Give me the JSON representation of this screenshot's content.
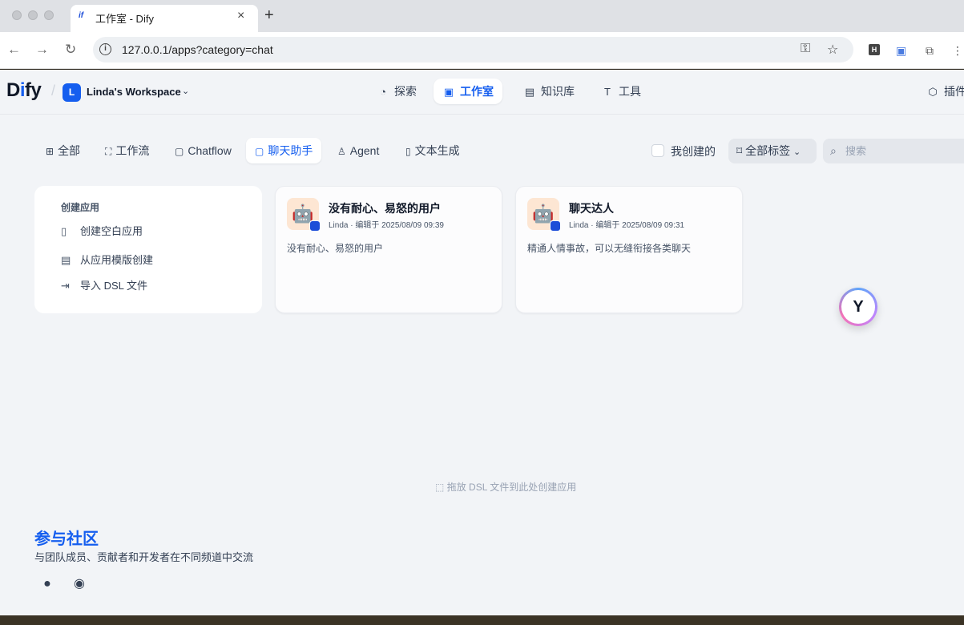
{
  "browser": {
    "tab_title": "工作室 - Dify",
    "tab_favicon": "if",
    "url": "127.0.0.1/apps?category=chat"
  },
  "header": {
    "logo_prefix": "D",
    "logo_i": "i",
    "logo_suffix": "fy",
    "workspace_initial": "L",
    "workspace_name": "Linda's Workspace",
    "nav": [
      {
        "label": "探索",
        "icon": "compass-icon"
      },
      {
        "label": "工作室",
        "icon": "robot-icon"
      },
      {
        "label": "知识库",
        "icon": "book-icon"
      },
      {
        "label": "工具",
        "icon": "hammer-icon"
      }
    ],
    "plugin_label": "插件"
  },
  "filters": {
    "tabs": [
      {
        "label": "全部"
      },
      {
        "label": "工作流"
      },
      {
        "label": "Chatflow"
      },
      {
        "label": "聊天助手"
      },
      {
        "label": "Agent"
      },
      {
        "label": "文本生成"
      }
    ],
    "mine_label": "我创建的",
    "tags_label": "全部标签",
    "search_placeholder": "搜索"
  },
  "create_card": {
    "title": "创建应用",
    "items": [
      {
        "label": "创建空白应用"
      },
      {
        "label": "从应用模版创建"
      },
      {
        "label": "导入 DSL 文件"
      }
    ]
  },
  "apps": [
    {
      "name": "没有耐心、易怒的用户",
      "meta": "Linda · 编辑于 2025/08/09 09:39",
      "description": "没有耐心、易怒的用户"
    },
    {
      "name": "聊天达人",
      "meta": "Linda · 编辑于 2025/08/09 09:31",
      "description": "精通人情事故，可以无缝衔接各类聊天"
    }
  ],
  "drop_hint": "拖放 DSL 文件到此处创建应用",
  "community": {
    "title": "参与社区",
    "subtitle": "与团队成员、贡献者和开发者在不同频道中交流"
  },
  "colors": {
    "accent": "#155eef",
    "background": "#f2f4f7"
  }
}
